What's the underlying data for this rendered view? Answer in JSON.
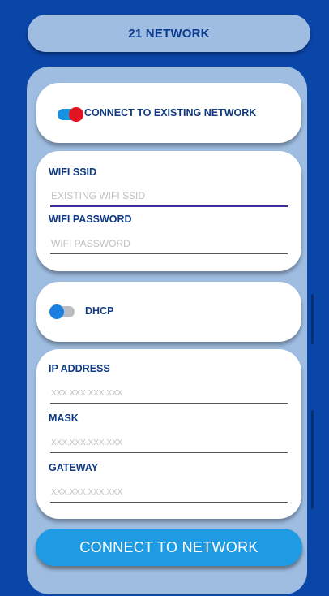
{
  "header": {
    "title": "21 NETWORK"
  },
  "connect_existing": {
    "label": "CONNECT TO EXISTING NETWORK",
    "toggle_on": true
  },
  "wifi": {
    "ssid_label": "WIFI SSID",
    "ssid_placeholder": "EXISTING WIFI SSID",
    "ssid_value": "",
    "password_label": "WIFI PASSWORD",
    "password_placeholder": "WIFI PASSWORD",
    "password_value": ""
  },
  "dhcp": {
    "label": "DHCP",
    "toggle_on": false
  },
  "ip_config": {
    "ip_label": "IP ADDRESS",
    "ip_placeholder": "XXX.XXX.XXX.XXX",
    "mask_label": "MASK",
    "mask_placeholder": "XXX.XXX.XXX.XXX",
    "gateway_label": "GATEWAY",
    "gateway_placeholder": "XXX.XXX.XXX.XXX"
  },
  "actions": {
    "connect_button": "CONNECT TO NETWORK"
  },
  "colors": {
    "background": "#0a45a8",
    "panel": "#9fbde1",
    "label_text": "#103a82",
    "button": "#1e9be3",
    "toggle_knob_on": "#e0141f",
    "toggle_track_on": "#1793e6"
  }
}
